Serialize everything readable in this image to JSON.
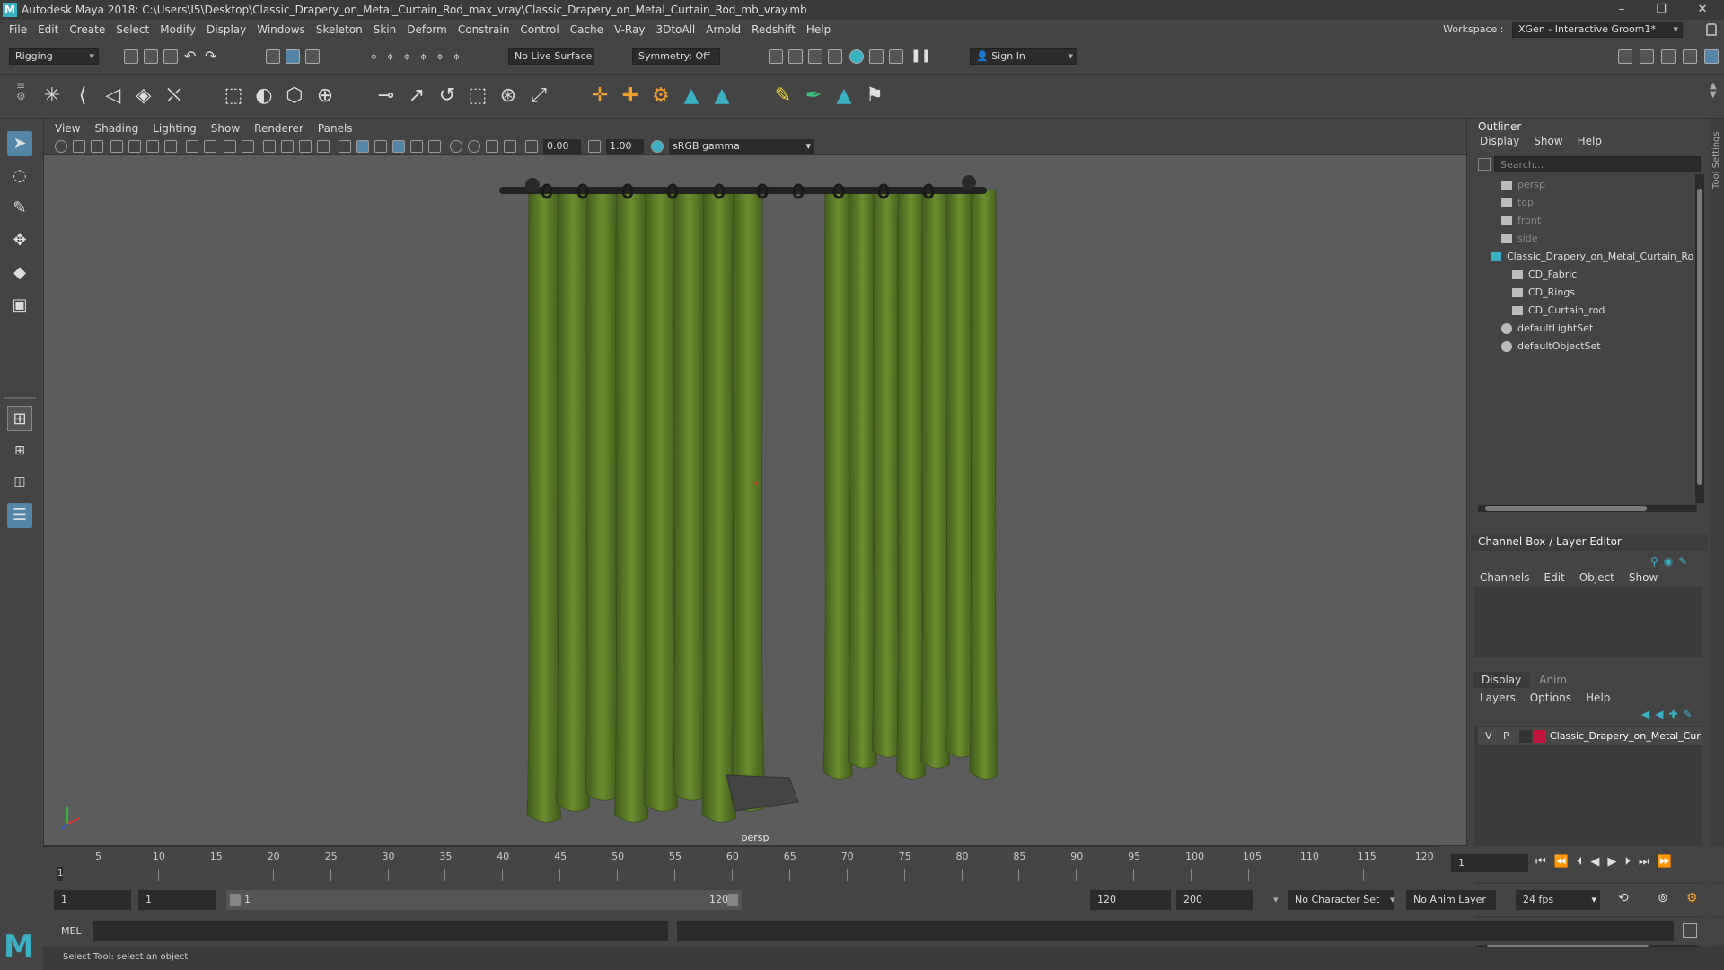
{
  "window": {
    "title": "Autodesk Maya 2018: C:\\Users\\I5\\Desktop\\Classic_Drapery_on_Metal_Curtain_Rod_max_vray\\Classic_Drapery_on_Metal_Curtain_Rod_mb_vray.mb",
    "minimize": "–",
    "restore": "❐",
    "close": "✕"
  },
  "menubar": {
    "items": [
      "File",
      "Edit",
      "Create",
      "Select",
      "Modify",
      "Display",
      "Windows",
      "Skeleton",
      "Skin",
      "Deform",
      "Constrain",
      "Control",
      "Cache",
      "V-Ray",
      "3DtoAll",
      "Arnold",
      "Redshift",
      "Help"
    ],
    "workspace_label": "Workspace :",
    "workspace_value": "XGen - Interactive Groom1*"
  },
  "statusline": {
    "mode": "Rigging",
    "live_surface": "No Live Surface",
    "symmetry": "Symmetry: Off",
    "sign_in": "Sign In"
  },
  "viewport": {
    "menus": [
      "View",
      "Shading",
      "Lighting",
      "Show",
      "Renderer",
      "Panels"
    ],
    "exposure": "0.00",
    "gamma": "1.00",
    "color_space": "sRGB gamma",
    "camera_label": "persp"
  },
  "outliner": {
    "title": "Outliner",
    "menus": [
      "Display",
      "Show",
      "Help"
    ],
    "search_placeholder": "Search...",
    "items": [
      {
        "label": "persp",
        "dim": true
      },
      {
        "label": "top",
        "dim": true
      },
      {
        "label": "front",
        "dim": true
      },
      {
        "label": "side",
        "dim": true
      },
      {
        "label": "Classic_Drapery_on_Metal_Curtain_Ro",
        "dim": false
      },
      {
        "label": "CD_Fabric",
        "dim": false
      },
      {
        "label": "CD_Rings",
        "dim": false
      },
      {
        "label": "CD_Curtain_rod",
        "dim": false
      },
      {
        "label": "defaultLightSet",
        "dim": false
      },
      {
        "label": "defaultObjectSet",
        "dim": false
      }
    ]
  },
  "channelbox": {
    "title": "Channel Box / Layer Editor",
    "menus": [
      "Channels",
      "Edit",
      "Object",
      "Show"
    ]
  },
  "layers": {
    "tabs": [
      "Display",
      "Anim"
    ],
    "menus": [
      "Layers",
      "Options",
      "Help"
    ],
    "row": {
      "v": "V",
      "p": "P",
      "name": "Classic_Drapery_on_Metal_Cur",
      "color": "#c0143c"
    }
  },
  "timeline": {
    "ticks": [
      "5",
      "10",
      "15",
      "20",
      "25",
      "30",
      "35",
      "40",
      "45",
      "50",
      "55",
      "60",
      "65",
      "70",
      "75",
      "80",
      "85",
      "90",
      "95",
      "100",
      "105",
      "110",
      "115",
      "120"
    ],
    "start_marker": "1",
    "current_frame": "1"
  },
  "range": {
    "start": "1",
    "playback_start": "1",
    "slider_start": "1",
    "slider_end": "120",
    "playback_end": "120",
    "end": "200",
    "character_set": "No Character Set",
    "anim_layer": "No Anim Layer",
    "fps": "24 fps"
  },
  "cmdline": {
    "lang": "MEL"
  },
  "helpline": {
    "text": "Select Tool: select an object"
  },
  "colors": {
    "curtain": "#5a7a2a",
    "rod": "#222222",
    "accent": "#3bb0c4",
    "layer": "#c0143c"
  }
}
